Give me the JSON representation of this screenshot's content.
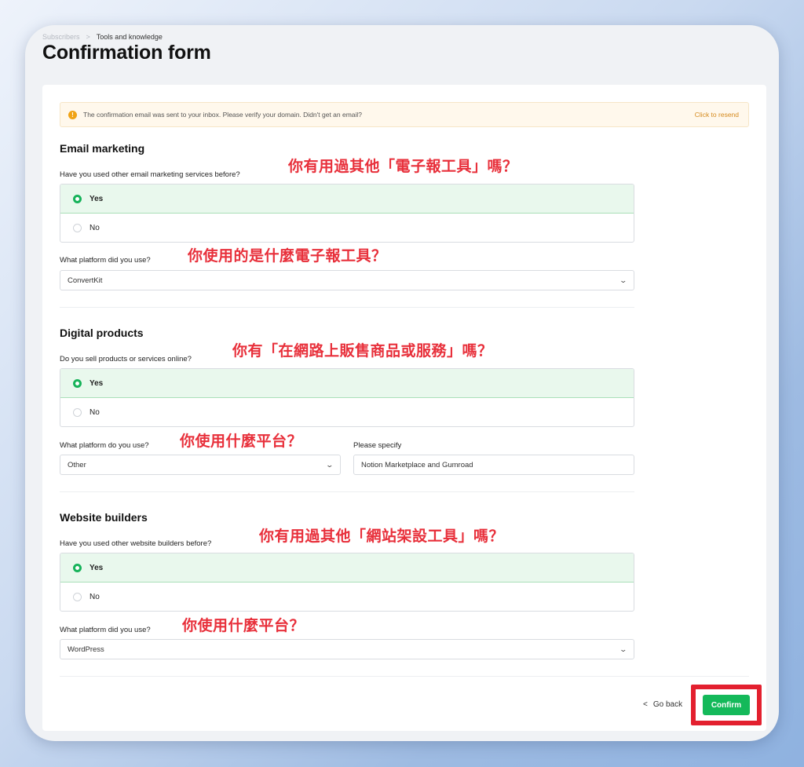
{
  "breadcrumb": {
    "parent": "Subscribers",
    "separator": ">",
    "current": "Tools and knowledge"
  },
  "page_title": "Confirmation form",
  "banner": {
    "message": "The confirmation email was sent to your inbox. Please verify your domain. Didn't get an email?",
    "action": "Click to resend",
    "icon": "warning-icon"
  },
  "sections": {
    "email": {
      "title": "Email marketing",
      "question": "Have you used other email marketing services before?",
      "options": [
        "Yes",
        "No"
      ],
      "selected": "Yes",
      "platform_label": "What platform did you use?",
      "platform_value": "ConvertKit",
      "annot_question": "你有用過其他「電子報工具」嗎？",
      "annot_platform": "你使用的是什麼電子報工具？"
    },
    "digital": {
      "title": "Digital products",
      "question": "Do you sell products or services online?",
      "options": [
        "Yes",
        "No"
      ],
      "selected": "Yes",
      "platform_label": "What platform do you use?",
      "platform_value": "Other",
      "specify_label": "Please specify",
      "specify_value": "Notion Marketplace and Gumroad",
      "annot_question": "你有「在網路上販售商品或服務」嗎？",
      "annot_platform": "你使用什麼平台？"
    },
    "website": {
      "title": "Website builders",
      "question": "Have you used other website builders before?",
      "options": [
        "Yes",
        "No"
      ],
      "selected": "Yes",
      "platform_label": "What platform did you use?",
      "platform_value": "WordPress",
      "annot_question": "你有用過其他「網站架設工具」嗎？",
      "annot_platform": "你使用什麼平台？"
    }
  },
  "footer": {
    "back_arrow": "<",
    "back_label": "Go back",
    "confirm_label": "Confirm"
  },
  "colors": {
    "accent_green": "#14b95a",
    "highlight_red": "#e3202f",
    "annotation_red": "#e8303b",
    "warning": "#f0a316"
  }
}
